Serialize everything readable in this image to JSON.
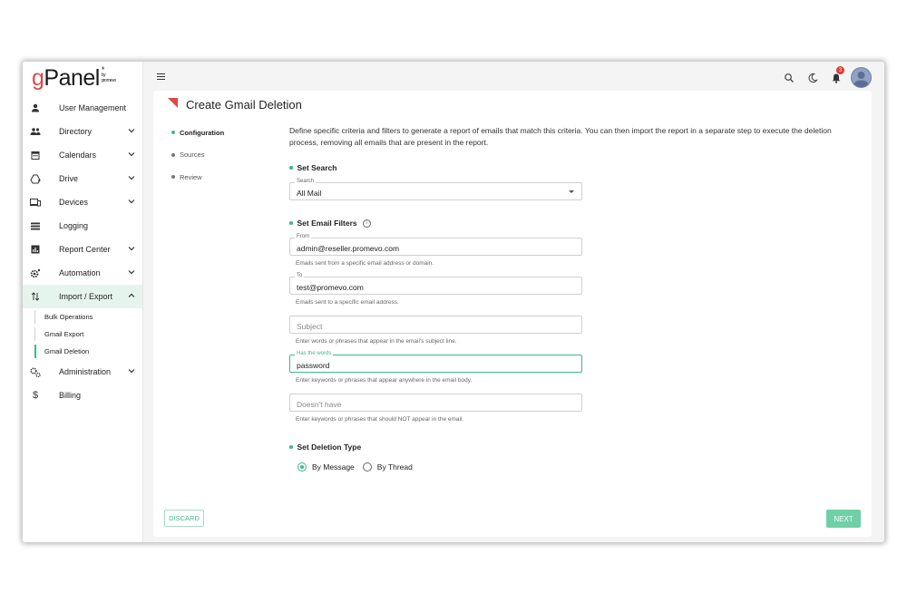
{
  "app": {
    "logo_g": "g",
    "logo_rest": "Panel",
    "logo_by": "by",
    "logo_brand": "promevo"
  },
  "sidebar": {
    "items": [
      {
        "label": "User Management",
        "icon": "person-icon"
      },
      {
        "label": "Directory",
        "icon": "group-icon"
      },
      {
        "label": "Calendars",
        "icon": "calendar-icon"
      },
      {
        "label": "Drive",
        "icon": "drive-icon"
      },
      {
        "label": "Devices",
        "icon": "devices-icon"
      },
      {
        "label": "Logging",
        "icon": "list-icon"
      },
      {
        "label": "Report Center",
        "icon": "report-icon"
      },
      {
        "label": "Automation",
        "icon": "gear-icon"
      },
      {
        "label": "Import / Export",
        "icon": "import-export-icon"
      },
      {
        "label": "Administration",
        "icon": "admin-gears-icon"
      },
      {
        "label": "Billing",
        "icon": "dollar-icon"
      }
    ],
    "sub_items": [
      "Bulk Operations",
      "Gmail Export",
      "Gmail Deletion"
    ]
  },
  "topbar": {
    "notification_count": "3"
  },
  "page": {
    "title": "Create Gmail Deletion",
    "steps": [
      "Configuration",
      "Sources",
      "Review"
    ],
    "description": "Define specific criteria and filters to generate a report of emails that match this criteria. You can then import the report in a separate step to execute the deletion process, removing all emails that are present in the report.",
    "set_search": {
      "heading": "Set Search",
      "label": "Search",
      "value": "All Mail"
    },
    "set_filters": {
      "heading": "Set Email Filters",
      "info_glyph": "i",
      "from": {
        "label": "From",
        "value": "admin@reseller.promevo.com",
        "helper": "Emails sent from a specific email address or domain."
      },
      "to": {
        "label": "To",
        "value": "test@promevo.com",
        "helper": "Emails sent to a specific email address."
      },
      "subject": {
        "placeholder": "Subject",
        "helper": "Enter words or phrases that appear in the email's subject line."
      },
      "has_words": {
        "label": "Has the words",
        "value": "password",
        "helper": "Enter keywords or phrases that appear anywhere in the email body."
      },
      "doesnt_have": {
        "placeholder": "Doesn't have",
        "helper": "Enter keywords or phrases that should NOT appear in the email."
      }
    },
    "deletion_type": {
      "heading": "Set Deletion Type",
      "options": [
        "By Message",
        "By Thread"
      ],
      "selected": "By Message"
    },
    "discard_label": "DISCARD",
    "next_label": "NEXT"
  },
  "colors": {
    "accent": "#3fb98a",
    "brand_red": "#e04848",
    "next_button": "#6fd0a8"
  }
}
